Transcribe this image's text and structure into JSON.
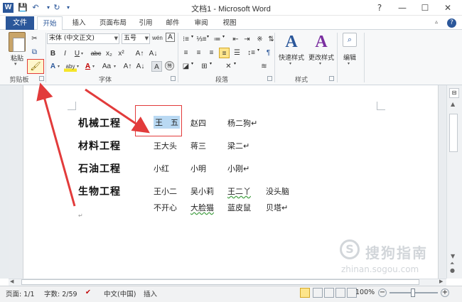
{
  "window": {
    "title": "文档1 - Microsoft Word",
    "controls": {
      "help": "?",
      "minimize": "—",
      "maximize": "☐",
      "close": "✕"
    }
  },
  "quick_access": {
    "app_icon": "W",
    "save_icon": "💾",
    "undo_icon": "↶",
    "redo_icon": "↻",
    "customize_icon": "▾"
  },
  "ribbon_tabs": [
    "文件",
    "开始",
    "插入",
    "页面布局",
    "引用",
    "邮件",
    "审阅",
    "视图"
  ],
  "active_tab": "开始",
  "ribbon": {
    "clipboard": {
      "label": "剪贴板",
      "paste_label": "粘贴",
      "cut_icon": "✂",
      "copy_icon": "⧉",
      "format_painter_icon": "🖌",
      "arrow_icon": "▾"
    },
    "font": {
      "label": "字体",
      "font_name": "宋体 (中文正文)",
      "font_size": "五号",
      "phonetic": "wén",
      "buttons": [
        "B",
        "I",
        "U",
        "abc",
        "x₂",
        "x²"
      ],
      "row3": [
        "A",
        "aby",
        "A",
        "Aa",
        "A↑",
        "A↓",
        "A",
        "㊕"
      ],
      "enclosed_char": "A",
      "clear_icon": "A"
    },
    "paragraph": {
      "label": "段落"
    },
    "styles": {
      "label": "样式",
      "quick_styles": "快速样式",
      "change_styles": "更改样式"
    },
    "editing": {
      "label": "编辑"
    },
    "accent_color": "#2b579a"
  },
  "document": {
    "rows": [
      {
        "heading": "机械工程",
        "cells": [
          "王　五",
          "赵四",
          "杨二狗↵"
        ]
      },
      {
        "heading": "材料工程",
        "cells": [
          "王大头",
          "蒋三",
          "梁二↵"
        ]
      },
      {
        "heading": "石油工程",
        "cells": [
          "小红",
          "小明",
          "小刚↵"
        ]
      },
      {
        "heading": "生物工程",
        "cells": [
          "王小二",
          "吴小莉",
          "王二丫",
          "没头脑"
        ]
      },
      {
        "heading": "",
        "cells": [
          "不开心",
          "大脸猫",
          "蓝皮鼠",
          "贝塔↵"
        ]
      }
    ],
    "trailing_mark": "↵",
    "selected_cell": "王　五"
  },
  "watermark": {
    "brand": "搜狗指南",
    "url": "zhinan.sogou.com",
    "logo": "S"
  },
  "status": {
    "page": "页面: 1/1",
    "words": "字数: 2/59",
    "proof_icon": "✔",
    "language": "中文(中国)",
    "insert_mode": "插入",
    "zoom": "100%",
    "zoom_minus": "−",
    "zoom_plus": "+"
  },
  "annotation_color": "#e23b3b"
}
